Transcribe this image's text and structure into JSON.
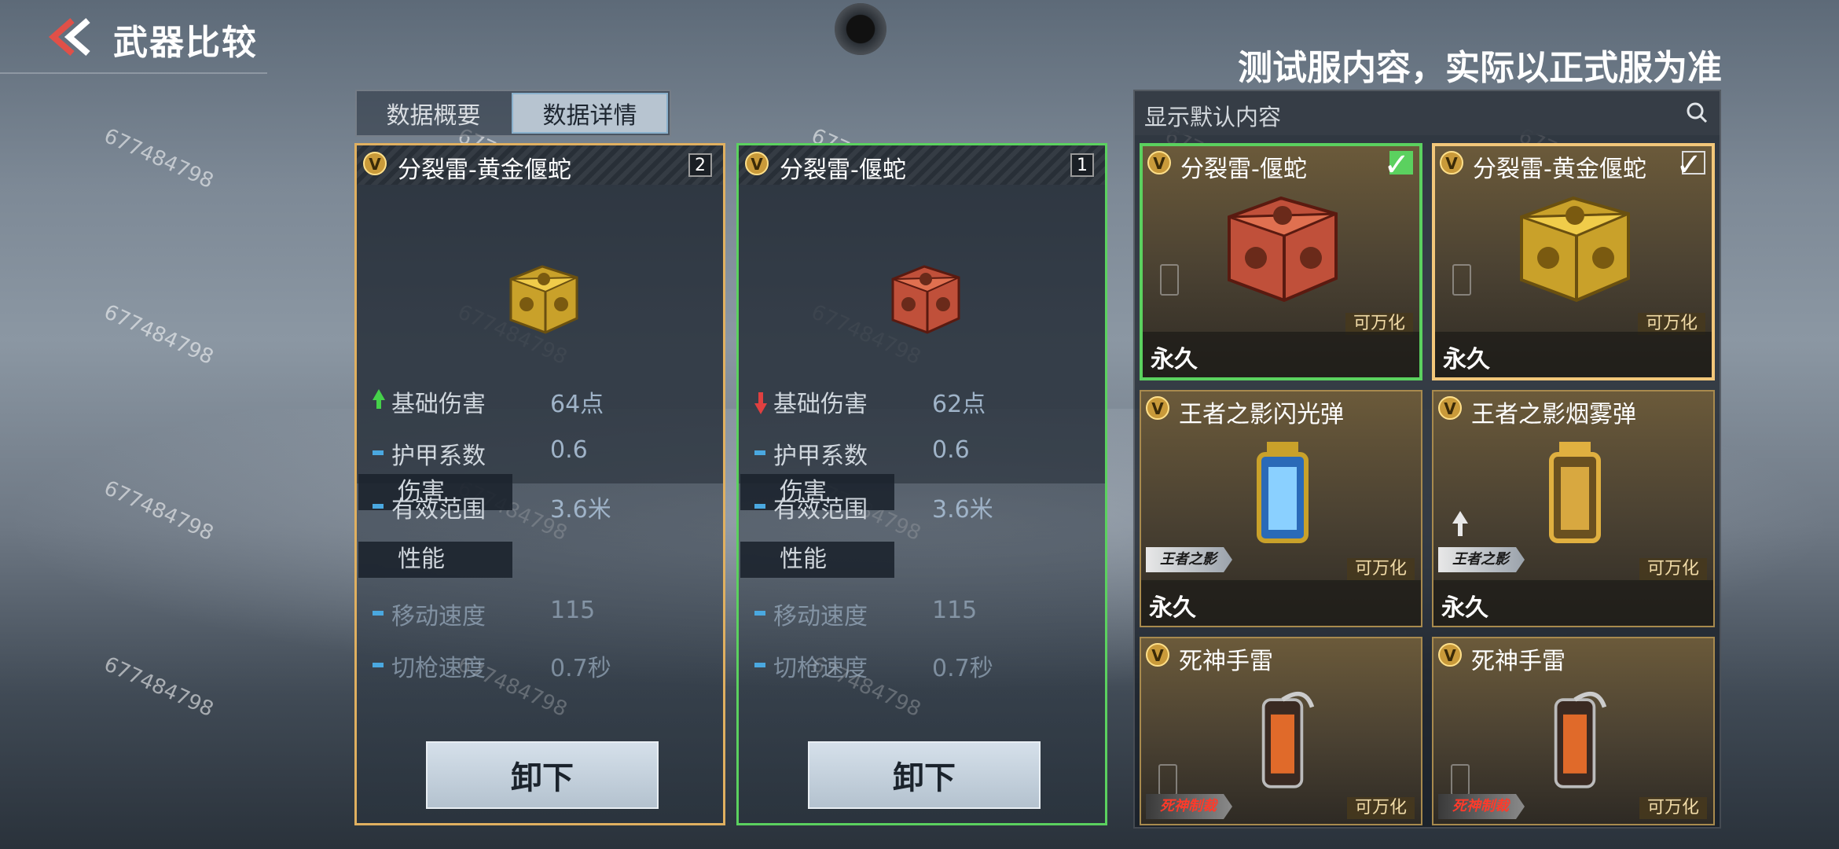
{
  "header": {
    "title": "武器比较",
    "notice": "测试服内容，实际以正式服为准"
  },
  "watermark": "677484798",
  "tabs": [
    {
      "label": "数据概要",
      "active": false
    },
    {
      "label": "数据详情",
      "active": true
    }
  ],
  "compare": [
    {
      "name": "分裂雷-黄金偃蛇",
      "slot": "2",
      "frame": "gold",
      "section_damage": "伤害",
      "stats_damage": [
        {
          "label": "基础伤害",
          "value": "64点",
          "trend": "up"
        },
        {
          "label": "护甲系数",
          "value": "0.6",
          "trend": "same"
        },
        {
          "label": "有效范围",
          "value": "3.6米",
          "trend": "same"
        }
      ],
      "section_perf": "性能",
      "stats_perf": [
        {
          "label": "移动速度",
          "value": "115",
          "trend": "same"
        },
        {
          "label": "切枪速度",
          "value": "0.7秒",
          "trend": "same"
        }
      ],
      "button": "卸下"
    },
    {
      "name": "分裂雷-偃蛇",
      "slot": "1",
      "frame": "green",
      "section_damage": "伤害",
      "stats_damage": [
        {
          "label": "基础伤害",
          "value": "62点",
          "trend": "down"
        },
        {
          "label": "护甲系数",
          "value": "0.6",
          "trend": "same"
        },
        {
          "label": "有效范围",
          "value": "3.6米",
          "trend": "same"
        }
      ],
      "section_perf": "性能",
      "stats_perf": [
        {
          "label": "移动速度",
          "value": "115",
          "trend": "same"
        },
        {
          "label": "切枪速度",
          "value": "0.7秒",
          "trend": "same"
        }
      ],
      "button": "卸下"
    }
  ],
  "inventory": {
    "search_placeholder": "显示默认内容",
    "items": [
      {
        "name": "分裂雷-偃蛇",
        "tag": "可万化",
        "duration": "永久",
        "state": "selected",
        "art": "red-cube"
      },
      {
        "name": "分裂雷-黄金偃蛇",
        "tag": "可万化",
        "duration": "永久",
        "state": "highlight",
        "art": "gold-cube"
      },
      {
        "name": "王者之影闪光弹",
        "tag": "可万化",
        "duration": "永久",
        "state": "normal",
        "art": "flash",
        "ribbon": "王者之影"
      },
      {
        "name": "王者之影烟雾弹",
        "tag": "可万化",
        "duration": "永久",
        "state": "normal",
        "art": "smoke",
        "ribbon": "王者之影"
      },
      {
        "name": "死神手雷",
        "tag": "可万化",
        "duration": "",
        "state": "normal",
        "art": "grenade",
        "ribbon": "死神制裁"
      },
      {
        "name": "死神手雷",
        "tag": "可万化",
        "duration": "",
        "state": "normal",
        "art": "grenade",
        "ribbon": "死神制裁"
      }
    ]
  },
  "colors": {
    "gold_frame": "#e0b060",
    "green_frame": "#5bd15f",
    "accent_blue": "#4aa8e0"
  }
}
